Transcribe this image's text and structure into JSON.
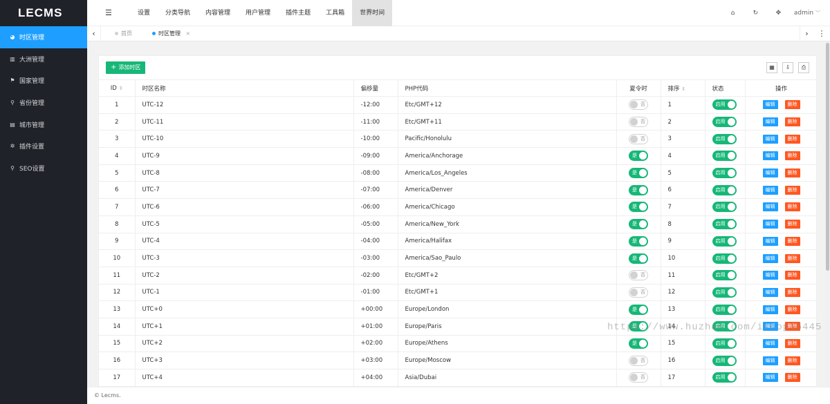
{
  "logo": "LECMS",
  "sidebar": {
    "items": [
      {
        "label": "时区管理",
        "icon": "globe-icon",
        "glyph": "◕",
        "active": true
      },
      {
        "label": "大洲管理",
        "icon": "map-icon",
        "glyph": "▥"
      },
      {
        "label": "国家管理",
        "icon": "flag-icon",
        "glyph": "⚑"
      },
      {
        "label": "省份管理",
        "icon": "location-icon",
        "glyph": "⚲"
      },
      {
        "label": "城市管理",
        "icon": "building-icon",
        "glyph": "▤"
      },
      {
        "label": "插件设置",
        "icon": "gear-icon",
        "glyph": "✲"
      },
      {
        "label": "SEO设置",
        "icon": "search-icon",
        "glyph": "⚲"
      }
    ]
  },
  "topbar": {
    "menu_toggle_glyph": "☰",
    "nav": [
      "设置",
      "分类导航",
      "内容管理",
      "用户管理",
      "插件主题",
      "工具箱",
      "世界时间"
    ],
    "active_nav": 6,
    "home_glyph": "⌂",
    "refresh_glyph": "↻",
    "fullscreen_glyph": "✥",
    "user": "admin",
    "user_caret": "﹀"
  },
  "tabs": {
    "left_arrow": "‹",
    "right_arrow": "›",
    "more": "⋮",
    "items": [
      {
        "label": "首页"
      },
      {
        "label": "时区管理",
        "close": "×",
        "active": true
      }
    ]
  },
  "toolbar": {
    "add_label": "添加时区",
    "add_glyph": "+",
    "columns_glyph": "▦",
    "export_glyph": "⇩",
    "print_glyph": "⎙"
  },
  "table": {
    "headers": [
      "ID",
      "时区名称",
      "偏移量",
      "PHP代码",
      "夏令时",
      "排序",
      "状态",
      "操作"
    ],
    "sort_glyph": "⇕",
    "yes_label": "是",
    "no_label": "否",
    "enabled_label": "启用",
    "edit_label": "编辑",
    "delete_label": "删除",
    "rows": [
      {
        "id": "1",
        "name": "UTC-12",
        "offset": "-12:00",
        "php": "Etc/GMT+12",
        "dst": false,
        "sort": "1"
      },
      {
        "id": "2",
        "name": "UTC-11",
        "offset": "-11:00",
        "php": "Etc/GMT+11",
        "dst": false,
        "sort": "2"
      },
      {
        "id": "3",
        "name": "UTC-10",
        "offset": "-10:00",
        "php": "Pacific/Honolulu",
        "dst": false,
        "sort": "3"
      },
      {
        "id": "4",
        "name": "UTC-9",
        "offset": "-09:00",
        "php": "America/Anchorage",
        "dst": true,
        "sort": "4"
      },
      {
        "id": "5",
        "name": "UTC-8",
        "offset": "-08:00",
        "php": "America/Los_Angeles",
        "dst": true,
        "sort": "5"
      },
      {
        "id": "6",
        "name": "UTC-7",
        "offset": "-07:00",
        "php": "America/Denver",
        "dst": true,
        "sort": "6"
      },
      {
        "id": "7",
        "name": "UTC-6",
        "offset": "-06:00",
        "php": "America/Chicago",
        "dst": true,
        "sort": "7"
      },
      {
        "id": "8",
        "name": "UTC-5",
        "offset": "-05:00",
        "php": "America/New_York",
        "dst": true,
        "sort": "8"
      },
      {
        "id": "9",
        "name": "UTC-4",
        "offset": "-04:00",
        "php": "America/Halifax",
        "dst": true,
        "sort": "9"
      },
      {
        "id": "10",
        "name": "UTC-3",
        "offset": "-03:00",
        "php": "America/Sao_Paulo",
        "dst": true,
        "sort": "10"
      },
      {
        "id": "11",
        "name": "UTC-2",
        "offset": "-02:00",
        "php": "Etc/GMT+2",
        "dst": false,
        "sort": "11"
      },
      {
        "id": "12",
        "name": "UTC-1",
        "offset": "-01:00",
        "php": "Etc/GMT+1",
        "dst": false,
        "sort": "12"
      },
      {
        "id": "13",
        "name": "UTC+0",
        "offset": "+00:00",
        "php": "Europe/London",
        "dst": true,
        "sort": "13"
      },
      {
        "id": "14",
        "name": "UTC+1",
        "offset": "+01:00",
        "php": "Europe/Paris",
        "dst": true,
        "sort": "14"
      },
      {
        "id": "15",
        "name": "UTC+2",
        "offset": "+02:00",
        "php": "Europe/Athens",
        "dst": true,
        "sort": "15"
      },
      {
        "id": "16",
        "name": "UTC+3",
        "offset": "+03:00",
        "php": "Europe/Moscow",
        "dst": false,
        "sort": "16"
      },
      {
        "id": "17",
        "name": "UTC+4",
        "offset": "+04:00",
        "php": "Asia/Dubai",
        "dst": false,
        "sort": "17"
      }
    ]
  },
  "footer": "© Lecms.",
  "watermark": "https://www.huzhan.com/ishop16445",
  "colors": {
    "sidebar": "#20222a",
    "accent": "#1e9fff",
    "green": "#16b777",
    "danger": "#ff5722"
  }
}
